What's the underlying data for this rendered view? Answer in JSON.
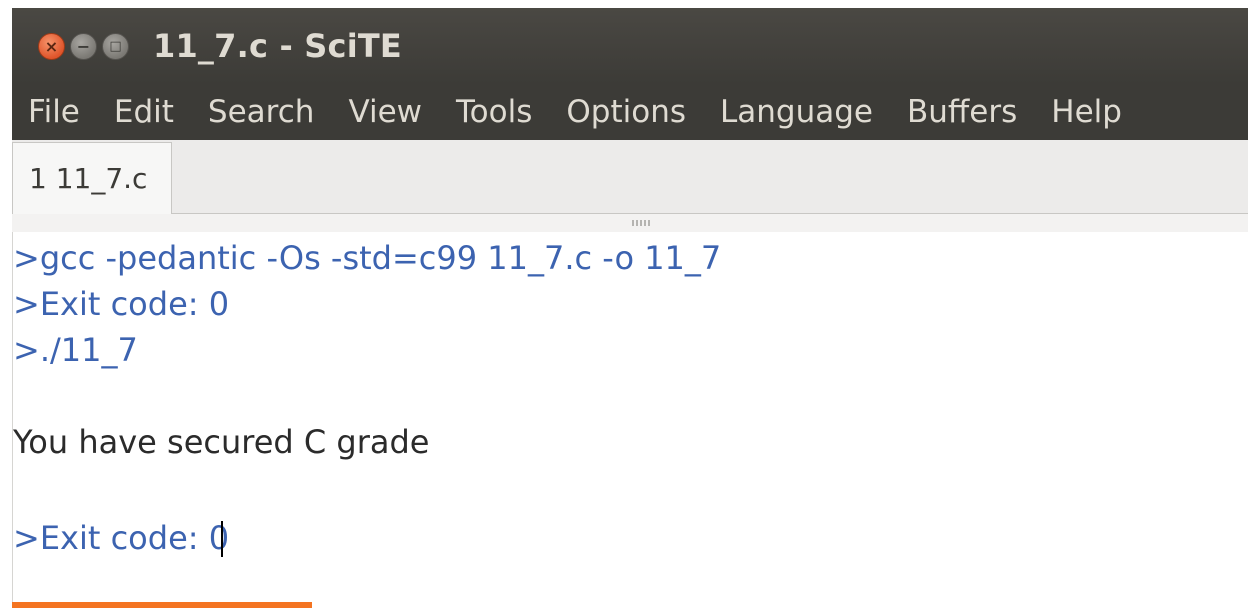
{
  "window": {
    "title": "11_7.c - SciTE",
    "buttons": {
      "close": "×",
      "minimize": "−",
      "maximize": "□"
    }
  },
  "menu": [
    "File",
    "Edit",
    "Search",
    "View",
    "Tools",
    "Options",
    "Language",
    "Buffers",
    "Help"
  ],
  "tabs": [
    {
      "label": "1 11_7.c"
    }
  ],
  "output": {
    "lines": [
      ">gcc -pedantic -Os -std=c99 11_7.c -o 11_7",
      ">Exit code: 0",
      ">./11_7",
      "",
      "You have secured C grade",
      "",
      ">Exit code: 0"
    ]
  },
  "colors": {
    "titlebar": "#3c3b37",
    "close_button": "#e0552b",
    "command_text": "#3c63b0",
    "accent": "#f47421"
  }
}
